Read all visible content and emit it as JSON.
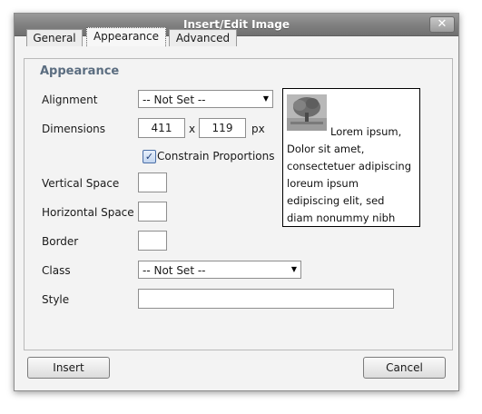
{
  "dialog": {
    "title": "Insert/Edit Image",
    "close_symbol": "✕"
  },
  "tabs": [
    {
      "label": "General",
      "active": false
    },
    {
      "label": "Appearance",
      "active": true
    },
    {
      "label": "Advanced",
      "active": false
    }
  ],
  "section_title": "Appearance",
  "fields": {
    "alignment": {
      "label": "Alignment",
      "value": "-- Not Set --"
    },
    "dimensions": {
      "label": "Dimensions",
      "width": "411",
      "separator": "x",
      "height": "119",
      "unit": "px"
    },
    "constrain": {
      "label": "Constrain Proportions",
      "checked": true,
      "check_symbol": "✓"
    },
    "vertical_space": {
      "label": "Vertical Space",
      "value": ""
    },
    "horizontal_space": {
      "label": "Horizontal Space",
      "value": ""
    },
    "border": {
      "label": "Border",
      "value": ""
    },
    "class": {
      "label": "Class",
      "value": "-- Not Set --"
    },
    "style": {
      "label": "Style",
      "value": ""
    }
  },
  "preview": {
    "image_icon": "tree-image-icon",
    "lines": [
      "Lorem ipsum,",
      "Dolor sit amet,",
      "consectetuer adipiscing",
      "loreum ipsum",
      "edipiscing elit, sed",
      "diam nonummy nibh"
    ]
  },
  "buttons": {
    "insert": "Insert",
    "cancel": "Cancel"
  },
  "colors": {
    "section_title": "#5b6d80",
    "title_bar": "#7f7f7f",
    "dialog_bg": "#f3f3f3"
  }
}
